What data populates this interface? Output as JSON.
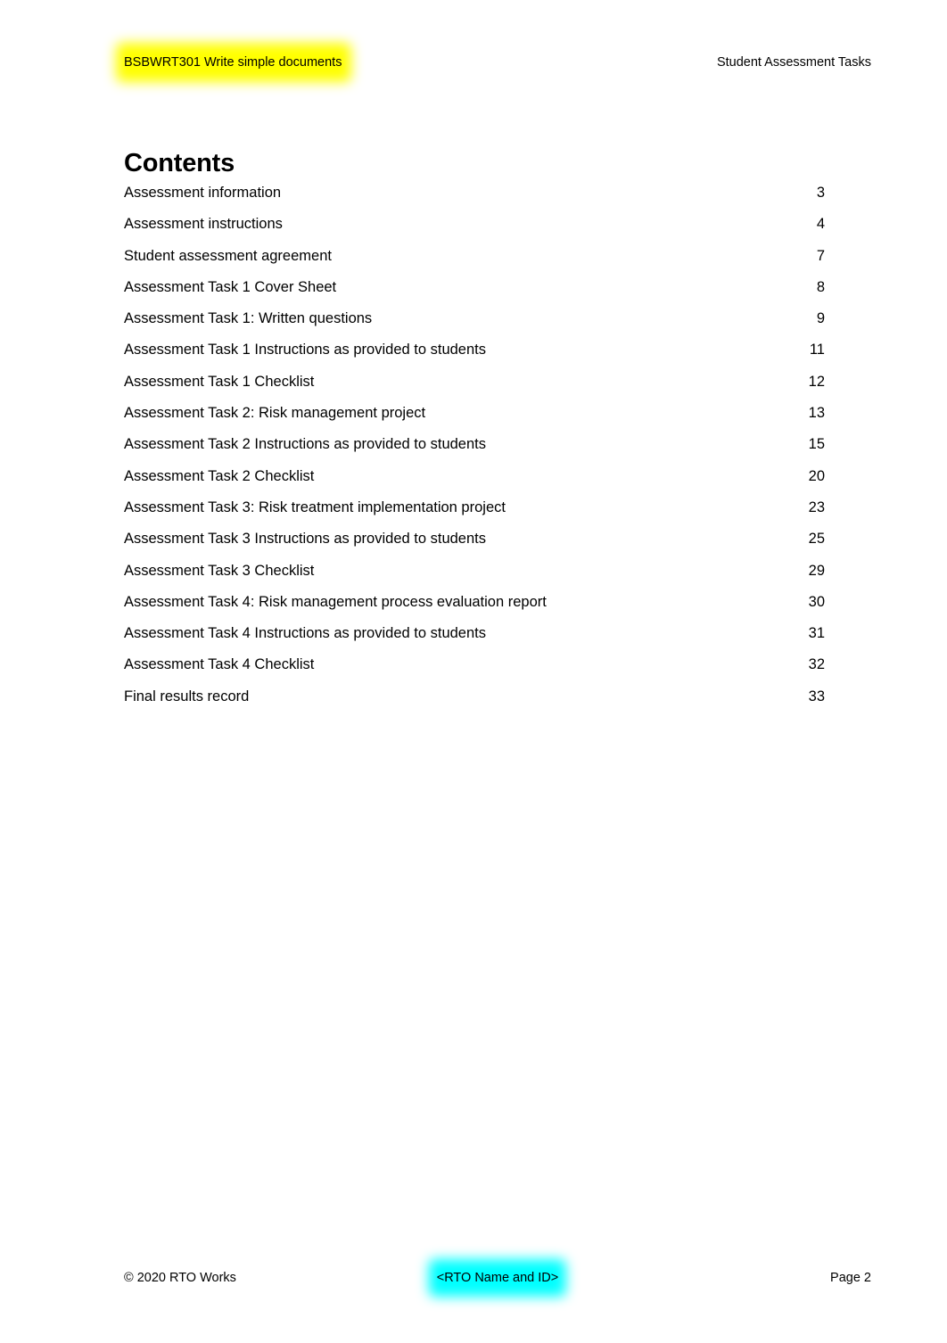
{
  "header": {
    "unit_code_title": "BSBWRT301 Write simple documents",
    "unit_code_highlight_color": "#ffff00",
    "document_type": "Student Assessment Tasks"
  },
  "contents": {
    "heading": "Contents",
    "entries": [
      {
        "title": "Assessment information",
        "page": "3"
      },
      {
        "title": "Assessment instructions",
        "page": "4"
      },
      {
        "title": "Student assessment agreement",
        "page": "7"
      },
      {
        "title": "Assessment Task 1 Cover Sheet",
        "page": "8"
      },
      {
        "title": "Assessment Task 1: Written questions",
        "page": "9"
      },
      {
        "title": "Assessment Task 1 Instructions as provided to students",
        "page": "11"
      },
      {
        "title": "Assessment Task 1 Checklist",
        "page": "12"
      },
      {
        "title": "Assessment Task 2: Risk management project",
        "page": "13"
      },
      {
        "title": "Assessment Task 2 Instructions as provided to students",
        "page": "15"
      },
      {
        "title": "Assessment Task 2 Checklist",
        "page": "20"
      },
      {
        "title": "Assessment Task 3: Risk treatment implementation project",
        "page": "23"
      },
      {
        "title": "Assessment Task 3 Instructions as provided to students",
        "page": "25"
      },
      {
        "title": "Assessment Task 3 Checklist",
        "page": "29"
      },
      {
        "title": "Assessment Task 4: Risk management process evaluation report",
        "page": "30"
      },
      {
        "title": "Assessment Task 4 Instructions as provided to students",
        "page": "31"
      },
      {
        "title": "Assessment Task 4 Checklist",
        "page": "32"
      },
      {
        "title": "Final results record",
        "page": "33"
      }
    ]
  },
  "footer": {
    "copyright": "© 2020 RTO Works",
    "rto_placeholder": "<RTO Name and ID>",
    "rto_placeholder_highlight_color": "#00ffff",
    "page_label": "Page 2"
  }
}
